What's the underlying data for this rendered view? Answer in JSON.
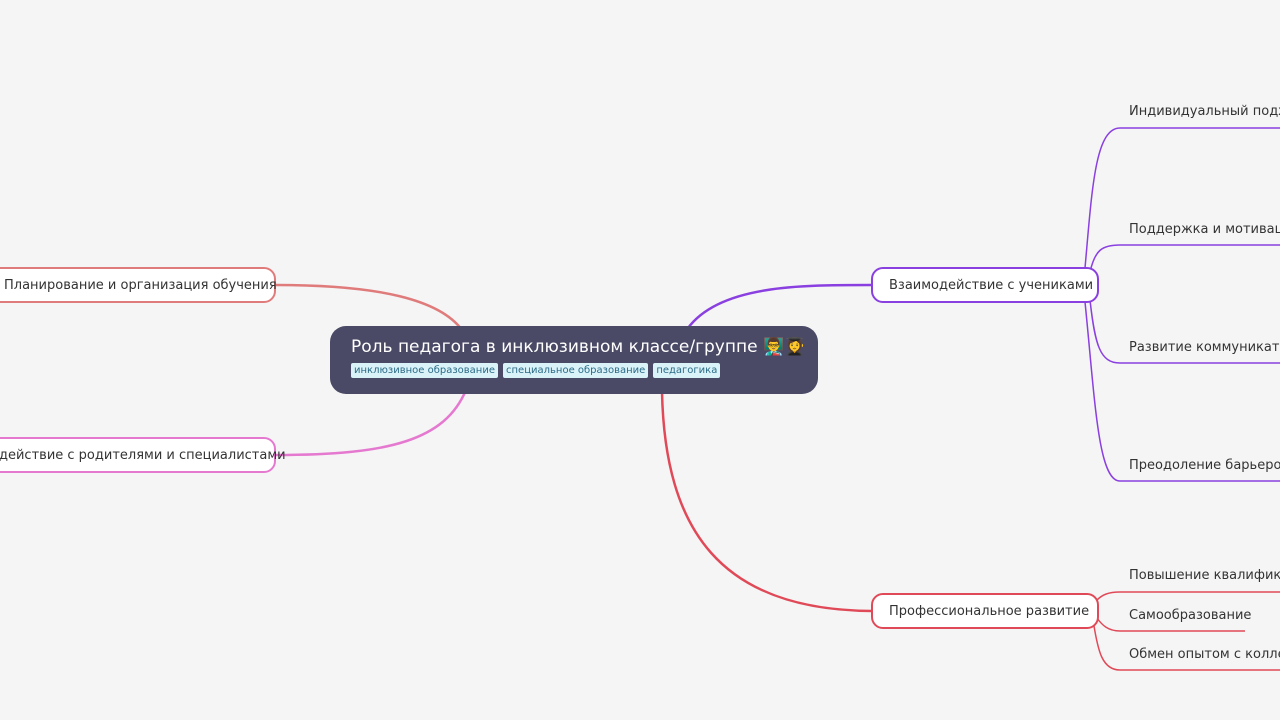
{
  "central": {
    "title": "Роль педагога в инклюзивном классе/группе 👨‍🏫👩‍🎓",
    "tags": [
      "инклюзивное образование",
      "специальное образование",
      "педагогика"
    ]
  },
  "branches": {
    "planning": {
      "label": "Планирование и организация обучения",
      "color": "#e07b7b"
    },
    "parents": {
      "label": "действие с родителями и специалистами",
      "color": "#e579d0"
    },
    "students": {
      "label": "Взаимодействие с учениками",
      "color": "#8a3fe0",
      "children": [
        "Индивидуальный подход",
        "Поддержка и мотивация",
        "Развитие коммуникатив",
        "Преодоление барьеров"
      ]
    },
    "professional": {
      "label": "Профессиональное развитие",
      "color": "#e04a58",
      "children": [
        "Повышение квалифика",
        "Самообразование",
        "Обмен опытом с коллега"
      ]
    }
  }
}
